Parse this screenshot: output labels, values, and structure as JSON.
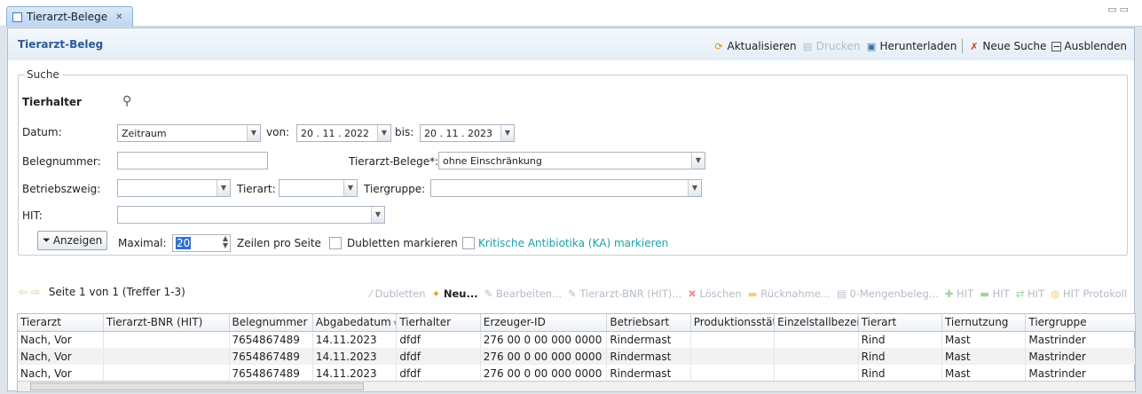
{
  "tab": {
    "title": "Tierarzt-Belege"
  },
  "panel": {
    "title": "Tierarzt-Beleg",
    "toolbar": {
      "refresh": "Aktualisieren",
      "print": "Drucken",
      "download": "Herunterladen",
      "new_search": "Neue Suche",
      "hide": "Ausblenden"
    }
  },
  "search": {
    "legend": "Suche",
    "tierhalter": "Tierhalter",
    "datum_label": "Datum:",
    "datum_value": "Zeitraum",
    "von_label": "von:",
    "von_value": "20 . 11 . 2022",
    "bis_label": "bis:",
    "bis_value": "20 . 11 . 2023",
    "belegnummer_label": "Belegnummer:",
    "belegnummer_value": "",
    "tierarzt_belege_label": "Tierarzt-Belege*:",
    "tierarzt_belege_value": "ohne Einschränkung",
    "betriebszweig_label": "Betriebszweig:",
    "tierart_label": "Tierart:",
    "tiergruppe_label": "Tiergruppe:",
    "hit_label": "HIT:",
    "anzeigen": "Anzeigen",
    "maximal_label": "Maximal:",
    "maximal_value": "20",
    "zeilen_label": "Zeilen pro Seite",
    "dubletten": "Dubletten markieren",
    "kritische": "Kritische Antibiotika (KA) markieren"
  },
  "grid": {
    "paging": "Seite 1 von 1 (Treffer 1-3)",
    "tools": {
      "dubletten": "Dubletten",
      "neu": "Neu...",
      "bearbeiten": "Bearbeiten...",
      "bnr": "Tierarzt-BNR (HIT)...",
      "loeschen": "Löschen",
      "ruecknahme": "Rücknahme...",
      "nullmenge": "0-Mengenbeleg...",
      "hit1": "HIT",
      "hit2": "HIT",
      "hit3": "HIT",
      "hit_protokoll": "HIT Protokoll"
    },
    "columns": [
      "Tierarzt",
      "Tierarzt-BNR (HIT)",
      "Belegnummer",
      "Abgabedatum",
      "Tierhalter",
      "Erzeuger-ID",
      "Betriebsart",
      "Produktionsstät",
      "Einzelstallbezeic",
      "Tierart",
      "Tiernutzung",
      "Tiergruppe"
    ],
    "rows": [
      [
        "Nach, Vor",
        "",
        "7654867489",
        "14.11.2023",
        "dfdf",
        "276 00 0 00 000 0000",
        "Rindermast",
        "",
        "",
        "Rind",
        "Mast",
        "Mastrinder"
      ],
      [
        "Nach, Vor",
        "",
        "7654867489",
        "14.11.2023",
        "dfdf",
        "276 00 0 00 000 0000",
        "Rindermast",
        "",
        "",
        "Rind",
        "Mast",
        "Mastrinder"
      ],
      [
        "Nach, Vor",
        "",
        "7654867489",
        "14.11.2023",
        "dfdf",
        "276 00 0 00 000 0000",
        "Rindermast",
        "",
        "",
        "Rind",
        "Mast",
        "Mastrinder"
      ]
    ]
  }
}
